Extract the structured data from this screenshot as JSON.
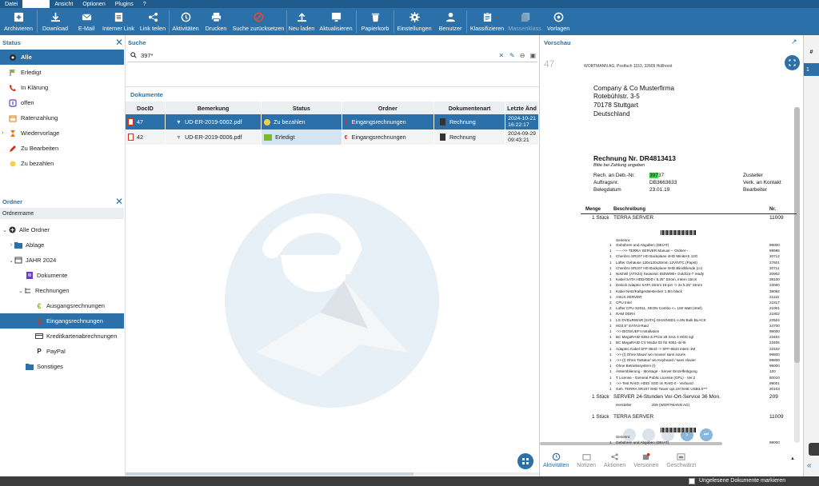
{
  "menu": {
    "items": [
      "Datei",
      "",
      "Ansicht",
      "Optionen",
      "Plugins",
      "?"
    ]
  },
  "toolbar": {
    "archivieren": "Archivieren",
    "download": "Download",
    "email": "E-Mail",
    "internerlink": "Interner Link",
    "linkteilen": "Link teilen",
    "aktivitaeten": "Aktivitäten",
    "drucken": "Drucken",
    "suchezurueck": "Suche zurücksetzen",
    "neuladen": "Neu laden",
    "aktualisieren": "Aktualisieren",
    "papierkorb": "Papierkorb",
    "einstellungen": "Einstellungen",
    "benutzer": "Benutzer",
    "klassifizieren": "Klassifizieren",
    "massenklass": "Massenklass.",
    "vorlagen": "Vorlagen"
  },
  "status_panel": {
    "title": "Status",
    "items": [
      "Alle",
      "Erledigt",
      "In Klärung",
      "offen",
      "Ratenzahlung",
      "Wiedervorlage",
      "Zu Bearbeiten",
      "Zu bezahlen"
    ]
  },
  "ordner_panel": {
    "title": "Ordner",
    "column": "Ordnername",
    "items": [
      "Alle Ordner",
      "Ablage",
      "JAHR 2024",
      "Dokumente",
      "Rechnungen",
      "Ausgangsrechnungen",
      "Eingangsrechnungen",
      "Kreditkartenabrechnungen",
      "PayPal",
      "Sonstiges"
    ]
  },
  "suche": {
    "title": "Suche",
    "query": "397*"
  },
  "dokumente": {
    "title": "Dokumente",
    "columns": [
      "DocID",
      "Bemerkung",
      "Status",
      "Ordner",
      "Dokumentenart",
      "Letzte Änd"
    ],
    "rows": [
      {
        "id": "47",
        "bemerkung": "UD-ER-2019-0002.pdf",
        "status": "Zu bezahlen",
        "ordner": "Eingangsrechnungen",
        "art": "Rechnung",
        "date": "2024-10-21",
        "time": "16:22:17"
      },
      {
        "id": "42",
        "bemerkung": "UD-ER-2019-0006.pdf",
        "status": "Erledigt",
        "ordner": "Eingangsrechnungen",
        "art": "Rechnung",
        "date": "2024-09-29",
        "time": "09:43:21"
      }
    ]
  },
  "vorschau": {
    "title": "Vorschau",
    "page_num": "47",
    "side_header": "#",
    "side_value": "1",
    "tabs": [
      "Aktivitäten",
      "Notizen",
      "Aktionen",
      "Versionen",
      "Geschwärzt"
    ]
  },
  "invoice": {
    "sender": "WORTMANN AG, Postfach 1153, 32609 Hüllhorst",
    "recipient": [
      "Company & Co Musterfirma",
      "Rotebühlstr. 3-5",
      "70178 Stuttgart",
      "Deutschland"
    ],
    "title": "Rechnung Nr. DR4813413",
    "subtitle": "Bitte bei Zahlung angeben",
    "meta_labels": [
      "Rech. an Deb.-Nr.",
      "Auftragsnr.",
      "Belegdatum"
    ],
    "meta_values_highlight": "397",
    "meta_values_rest": "37",
    "meta_values": [
      "DB3663633",
      "23.01.19"
    ],
    "meta_right": [
      "Zusteller",
      "Verk. an Kontakt",
      "Bearbeiter"
    ],
    "headers": [
      "Menge",
      "Beschreibung",
      "Nr."
    ],
    "line1": {
      "qty": "1 Stück",
      "desc": "TERRA SERVER",
      "nr": "11009"
    },
    "serial_label": "Seriennr.",
    "components": [
      [
        "1",
        "Gebühren und Abgaben (DE/AT)",
        "99000"
      ],
      [
        "1",
        "------>> TERRA SERVER Manual -- Ordner--",
        "99995"
      ],
      [
        "1",
        "Chenbro SR107 HD Backplane 4HD Mini6AS 12G",
        "20712"
      ],
      [
        "1",
        "Lüfter Gehäuse 120x120x25mm 12V/NTC (Papst)",
        "27601"
      ],
      [
        "1",
        "Chenbro SR107 HD Backplane 0HD Blindblende (cc)",
        "20711"
      ],
      [
        "1",
        "Netzteil (ATX24) Seasonic 650W/80+ Gold/24-7 ready",
        "20902"
      ],
      [
        "1",
        "Kabel SATA HDD/ODD / 5.25\" Strom, intern 15cm",
        "38100"
      ],
      [
        "1",
        "Delock Adapter SATA Strom 15-pin -> 2x 5.25\" Strom",
        "23000"
      ],
      [
        "1",
        "Kabel Netz/Kaltgerätestecker 1.8m black",
        "38092"
      ],
      [
        "1",
        "ASUS SERVER",
        "21110"
      ],
      [
        "2",
        "CPU Intel",
        "21817"
      ],
      [
        "2",
        "Lüfter CPU S2011, XEON Combo <= 150 Watt (Intel)",
        "21001"
      ],
      [
        "1",
        "RAM DDR4",
        "21802"
      ],
      [
        "1",
        "LG DVD±RW/sR [SATA] GH24NSD1 o.SN Bulk BLACK",
        "22504"
      ],
      [
        "1",
        "HD3,5\" SATA3-Raid",
        "24700"
      ],
      [
        "1",
        "->> BIOS/UEFI Installation",
        "99000"
      ],
      [
        "1",
        "BC MegaRAID 9361-4i PCIe x8 SAS 4 HDD sgl",
        "23404"
      ],
      [
        "1",
        "BC MegaRAID CV Modul 02 für 9361-4i/-8i",
        "23405"
      ],
      [
        "1",
        "Adaptec Kabel SFF-8643 -> SFF-8643 intern 1M",
        "23102"
      ],
      [
        "1",
        "->> (!) Ohne Maus/ wo mouse/ sans souris",
        "99800"
      ],
      [
        "1",
        "->> (!) Ohne Tastatur/ wo Keyboard / sans clavier",
        "99800"
      ],
      [
        "1",
        "Ohne Betriebssystem (!)",
        "99000"
      ],
      [
        "1",
        "Assemblierung - Montage - Server Einzelfertigung",
        "120"
      ],
      [
        "1",
        "T License - General Public License (GPL) - Ver.2",
        "80010"
      ],
      [
        "1",
        "->> Test RAID: HDD/ SSD im RAID 0 - Verbund",
        "99001"
      ],
      [
        "1",
        "Geh. TERRA SR107 8HD Tower opt.19\"/SHE USB3.0***",
        "20103"
      ]
    ],
    "line2": {
      "qty": "1 Stück",
      "desc": "SERVER 24-Stunden Vor-Ort-Service 36 Mon.",
      "nr": "209"
    },
    "hersteller": {
      "label": "Hersteller",
      "value": "209 (WORTMANN AG)"
    },
    "line3": {
      "qty": "1 Stück",
      "desc": "TERRA SERVER",
      "nr": "11009"
    },
    "serial_label2": "Seriennr.",
    "last_line": [
      "1",
      "Gebühren und Abgaben (DE/AT)",
      "99000"
    ]
  },
  "statusbar": {
    "checkbox_label": "Ungelesene Dokumente markieren"
  },
  "colors": {
    "accent": "#2b70a8",
    "green": "#7cb82f",
    "red": "#d9301c"
  }
}
